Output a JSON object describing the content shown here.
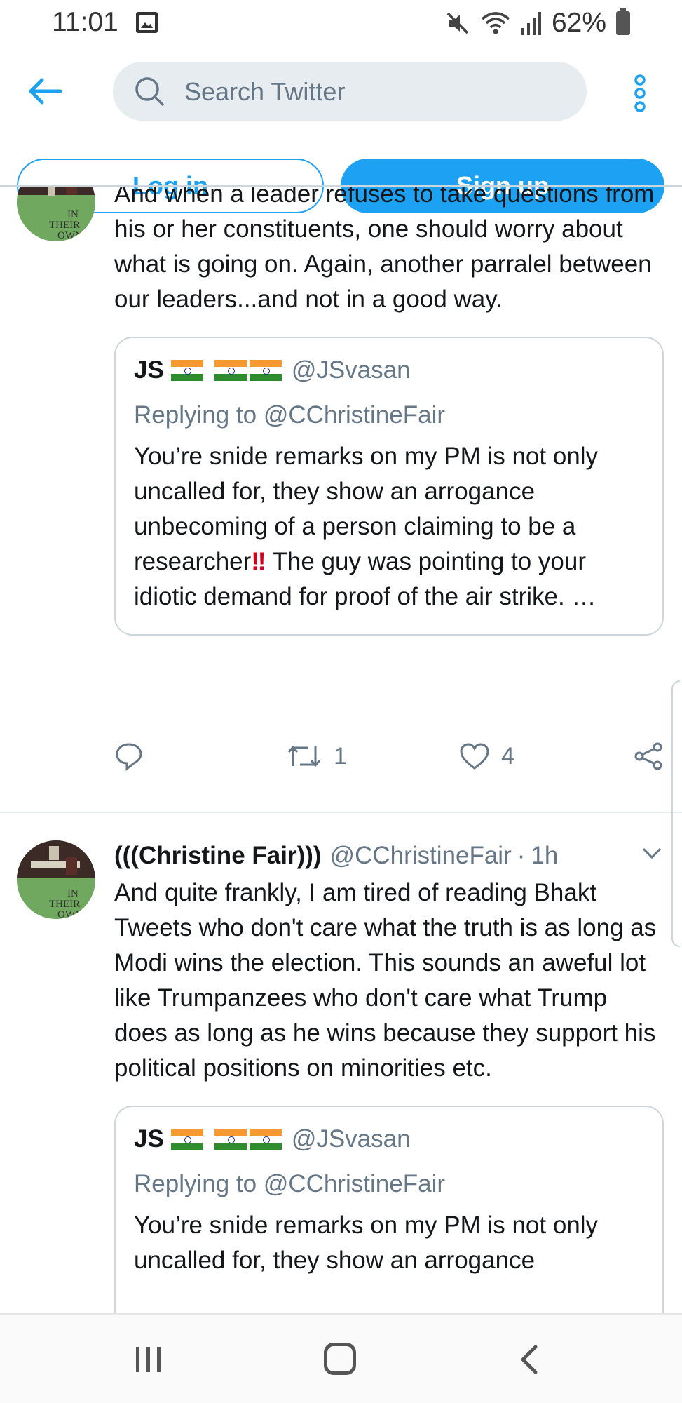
{
  "status_bar": {
    "time": "11:01",
    "battery": "62%",
    "icons": [
      "image-icon",
      "mute-icon",
      "wifi-icon",
      "signal-icon",
      "battery-icon"
    ]
  },
  "header": {
    "search_placeholder": "Search Twitter",
    "login_label": "Log in",
    "signup_label": "Sign up",
    "accent_color": "#1da1f2"
  },
  "tweets": [
    {
      "text": "And when a leader refuses to take questions from his or her constituents, one should worry about what is going on.  Again, another parralel between our leaders...and not in a good way.",
      "quote": {
        "name": "JS",
        "handle": "@JSvasan",
        "replying_to": "Replying to @CChristineFair",
        "text_before": "You’re snide remarks on my PM is not only uncalled for, they show an arrogance unbecoming of a person claiming to be a researcher",
        "emoji": "‼",
        "text_after": " The guy was pointing to your idiotic demand for proof of the air strike. …"
      },
      "retweets": "1",
      "likes": "4"
    },
    {
      "author_name": "(((Christine Fair)))",
      "author_handle": "@CChristineFair",
      "separator": "·",
      "time": "1h",
      "text": "And quite frankly, I am tired of reading Bhakt Tweets who don't care what the truth is as long as Modi wins the election. This sounds an aweful lot like Trumpanzees who don't care what Trump does as long as he wins because they support his political positions on minorities etc.",
      "quote": {
        "name": "JS",
        "handle": "@JSvasan",
        "replying_to": "Replying to @CChristineFair",
        "text": "You’re snide remarks on my PM is not only uncalled for, they show an arrogance"
      }
    }
  ],
  "avatar_text": "IN THEIR OWN",
  "colors": {
    "secondary_text": "#657786",
    "border": "#ccd6dd",
    "flag_saffron": "#f49a31",
    "flag_green": "#2e8b2e"
  }
}
